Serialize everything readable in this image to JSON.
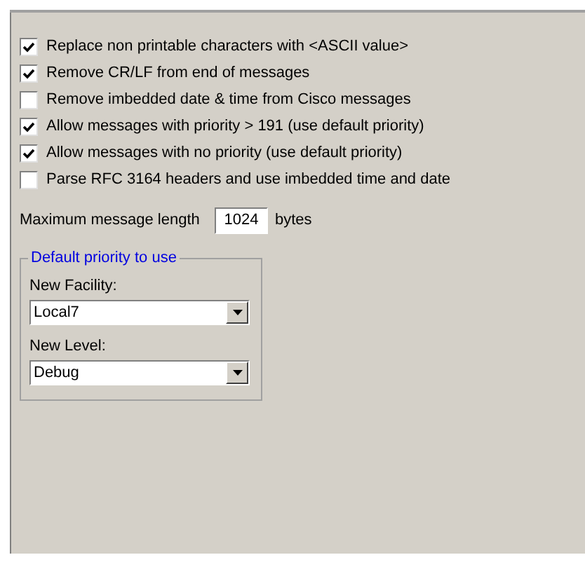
{
  "options": [
    {
      "label": "Replace non printable characters with <ASCII value>",
      "checked": true
    },
    {
      "label": "Remove CR/LF from end of messages",
      "checked": true
    },
    {
      "label": "Remove imbedded date & time from Cisco messages",
      "checked": false
    },
    {
      "label": "Allow messages with priority > 191 (use default priority)",
      "checked": true
    },
    {
      "label": "Allow messages with no priority (use default priority)",
      "checked": true
    },
    {
      "label": "Parse RFC 3164 headers and use imbedded time and date",
      "checked": false
    }
  ],
  "max_length": {
    "label": "Maximum message length",
    "value": "1024",
    "unit": "bytes"
  },
  "default_priority": {
    "title": "Default priority to use",
    "fields": [
      {
        "label": "New Facility:",
        "value": "Local7"
      },
      {
        "label": "New Level:",
        "value": "Debug"
      }
    ]
  }
}
